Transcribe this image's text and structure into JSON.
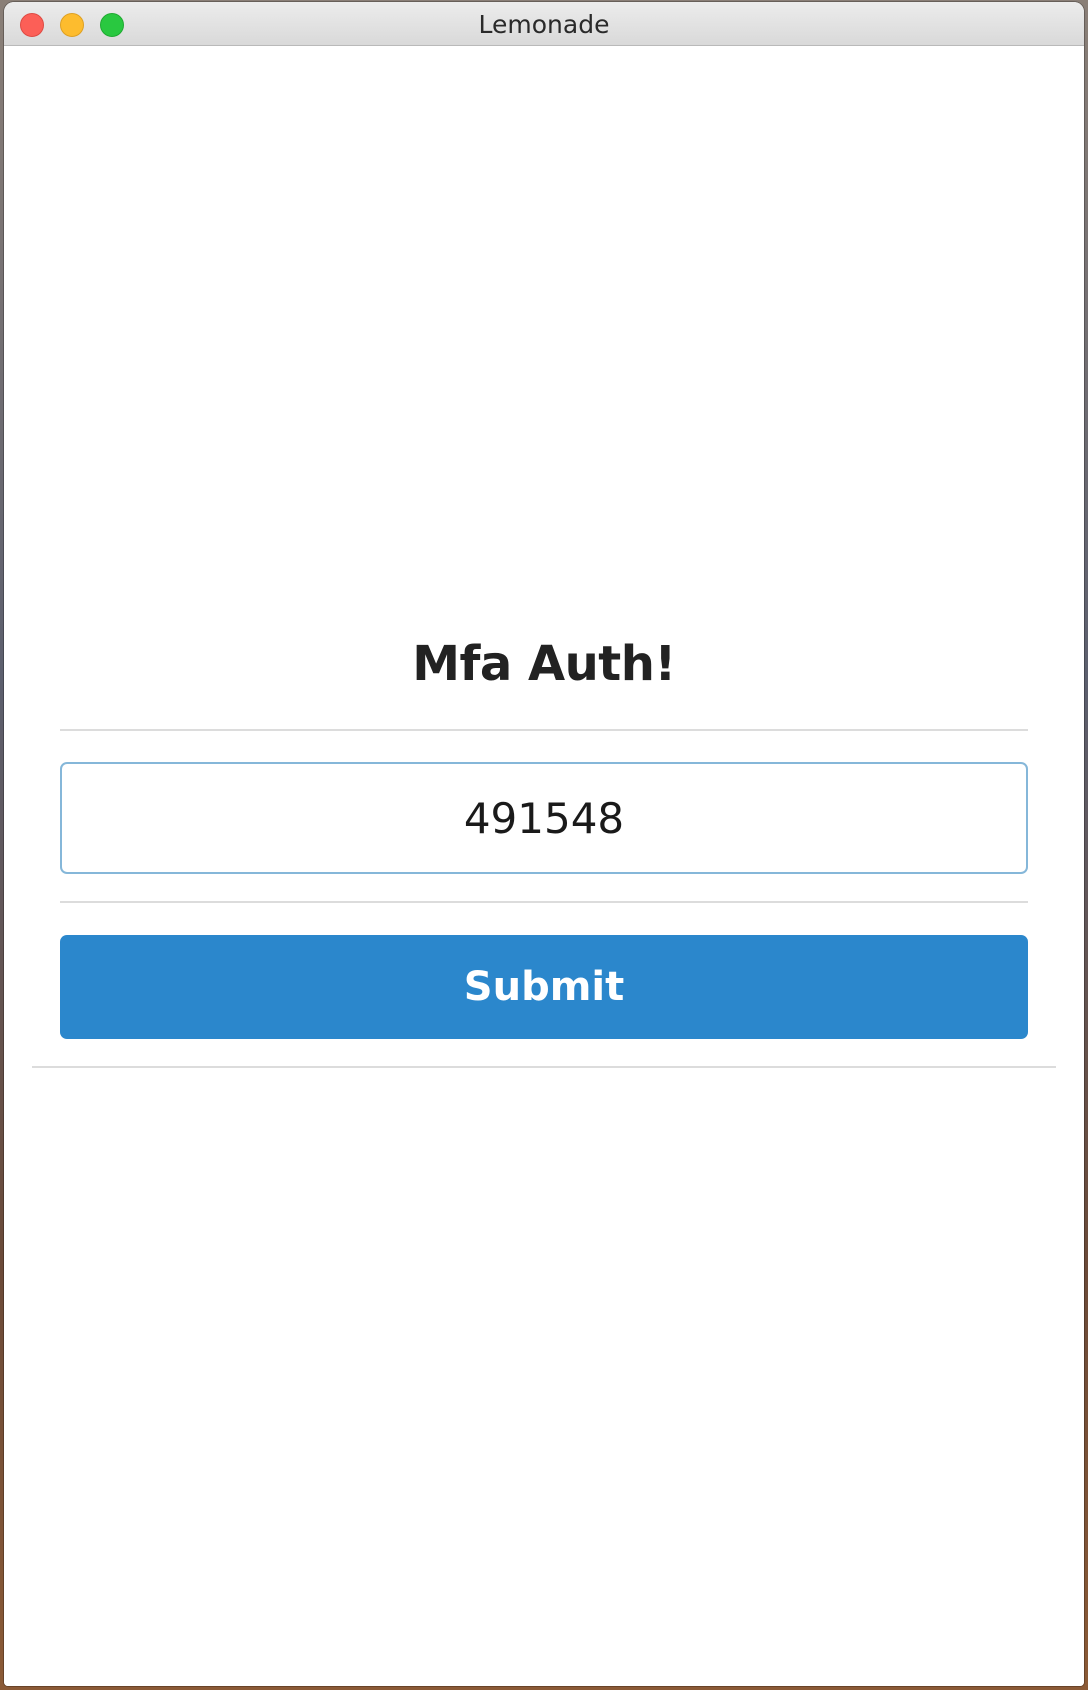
{
  "window": {
    "title": "Lemonade"
  },
  "form": {
    "heading": "Mfa Auth!",
    "code_value": "491548",
    "submit_label": "Submit"
  },
  "colors": {
    "accent": "#2b87cc",
    "input_border": "#85b7d9",
    "heading": "#222222",
    "divider": "#dcdcdc"
  },
  "icons": {
    "close": "close-icon",
    "minimize": "minimize-icon",
    "zoom": "zoom-icon"
  }
}
